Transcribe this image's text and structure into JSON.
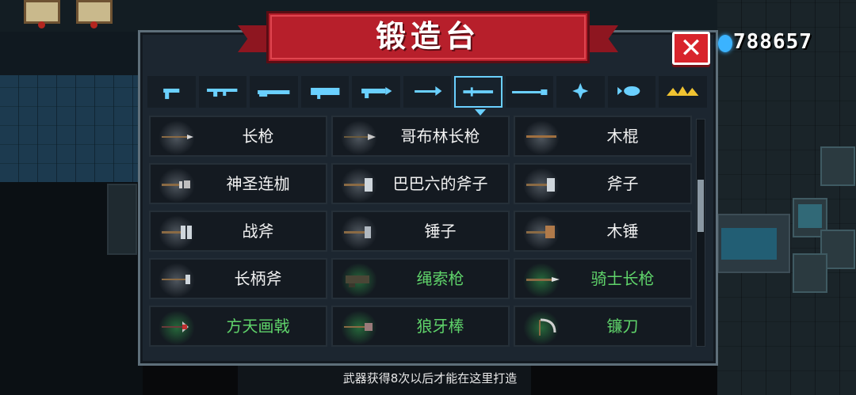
{
  "title": "锻造台",
  "currency": {
    "value": "788657",
    "icon": "gem-icon"
  },
  "close": {
    "icon": "close-icon",
    "label": "✕"
  },
  "tabs": [
    {
      "icon": "pistol-icon",
      "active": false
    },
    {
      "icon": "rifle-icon",
      "active": false
    },
    {
      "icon": "shotgun-icon",
      "active": false
    },
    {
      "icon": "launcher-icon",
      "active": false
    },
    {
      "icon": "laser-gun-icon",
      "active": false
    },
    {
      "icon": "bow-icon",
      "active": false
    },
    {
      "icon": "melee-weapon-icon",
      "active": true
    },
    {
      "icon": "staff-icon",
      "active": false
    },
    {
      "icon": "shuriken-icon",
      "active": false
    },
    {
      "icon": "fish-icon",
      "active": false
    },
    {
      "icon": "misc-gold-icon",
      "active": false
    }
  ],
  "weapons": [
    {
      "name": "长枪",
      "rarity": "white",
      "icon": "spear-icon"
    },
    {
      "name": "哥布林长枪",
      "rarity": "white",
      "icon": "goblin-spear-icon"
    },
    {
      "name": "木棍",
      "rarity": "white",
      "icon": "wooden-stick-icon"
    },
    {
      "name": "神圣连枷",
      "rarity": "white",
      "icon": "holy-flail-icon"
    },
    {
      "name": "巴巴六的斧子",
      "rarity": "white",
      "icon": "axe-icon"
    },
    {
      "name": "斧子",
      "rarity": "white",
      "icon": "axe-icon"
    },
    {
      "name": "战斧",
      "rarity": "white",
      "icon": "battle-axe-icon"
    },
    {
      "name": "锤子",
      "rarity": "white",
      "icon": "hammer-icon"
    },
    {
      "name": "木锤",
      "rarity": "white",
      "icon": "wooden-hammer-icon"
    },
    {
      "name": "长柄斧",
      "rarity": "white",
      "icon": "long-axe-icon"
    },
    {
      "name": "绳索枪",
      "rarity": "green",
      "icon": "rope-gun-icon"
    },
    {
      "name": "骑士长枪",
      "rarity": "green",
      "icon": "knight-lance-icon"
    },
    {
      "name": "方天画戟",
      "rarity": "green",
      "icon": "halberd-icon"
    },
    {
      "name": "狼牙棒",
      "rarity": "green",
      "icon": "mace-icon"
    },
    {
      "name": "镰刀",
      "rarity": "green",
      "icon": "scythe-icon"
    }
  ],
  "hint": "武器获得8次以后才能在这里打造",
  "colors": {
    "accent": "#6ad0ff",
    "banner": "#b71f2b",
    "green_rarity": "#5fd36a",
    "close": "#d8242c"
  }
}
